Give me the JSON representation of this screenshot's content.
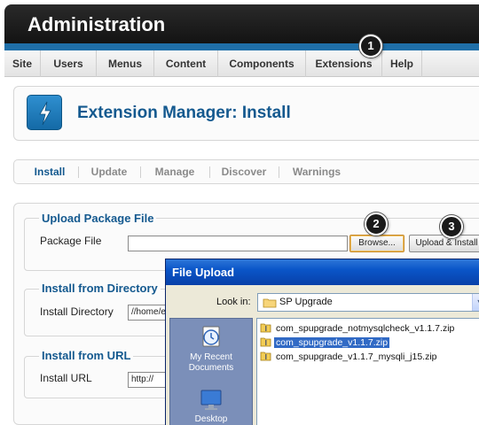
{
  "header": {
    "title": "Administration"
  },
  "menu": {
    "items": [
      {
        "label": "Site"
      },
      {
        "label": "Users"
      },
      {
        "label": "Menus"
      },
      {
        "label": "Content"
      },
      {
        "label": "Components"
      },
      {
        "label": "Extensions"
      },
      {
        "label": "Help"
      }
    ]
  },
  "callouts": [
    "1",
    "2",
    "3"
  ],
  "toolbar": {
    "title": "Extension Manager: Install",
    "icon": "lightning-icon"
  },
  "tabs": [
    {
      "label": "Install",
      "active": true
    },
    {
      "label": "Update"
    },
    {
      "label": "Manage"
    },
    {
      "label": "Discover"
    },
    {
      "label": "Warnings"
    }
  ],
  "upload": {
    "legend": "Upload Package File",
    "label": "Package File",
    "value": "",
    "browse_label": "Browse...",
    "install_label": "Upload & Install"
  },
  "directory": {
    "legend": "Install from Directory",
    "label": "Install Directory",
    "value": "//home/e"
  },
  "url": {
    "legend": "Install from URL",
    "label": "Install URL",
    "value": "http://"
  },
  "dialog": {
    "title": "File Upload",
    "look_in_label": "Look in:",
    "look_in_value": "SP Upgrade",
    "places": [
      {
        "label": "My Recent Documents",
        "icon": "recent-documents-icon"
      },
      {
        "label": "Desktop",
        "icon": "desktop-icon"
      }
    ],
    "files": [
      {
        "name": "com_spupgrade_notmysqlcheck_v1.1.7.zip",
        "selected": false
      },
      {
        "name": "com_spupgrade_v1.1.7.zip",
        "selected": true
      },
      {
        "name": "com_spupgrade_v1.1.7_mysqli_j15.zip",
        "selected": false
      }
    ]
  },
  "colors": {
    "accent": "#14598f",
    "bar": "#1f6fa8",
    "selection": "#316ac5",
    "titlebar": "#0a55c8"
  }
}
